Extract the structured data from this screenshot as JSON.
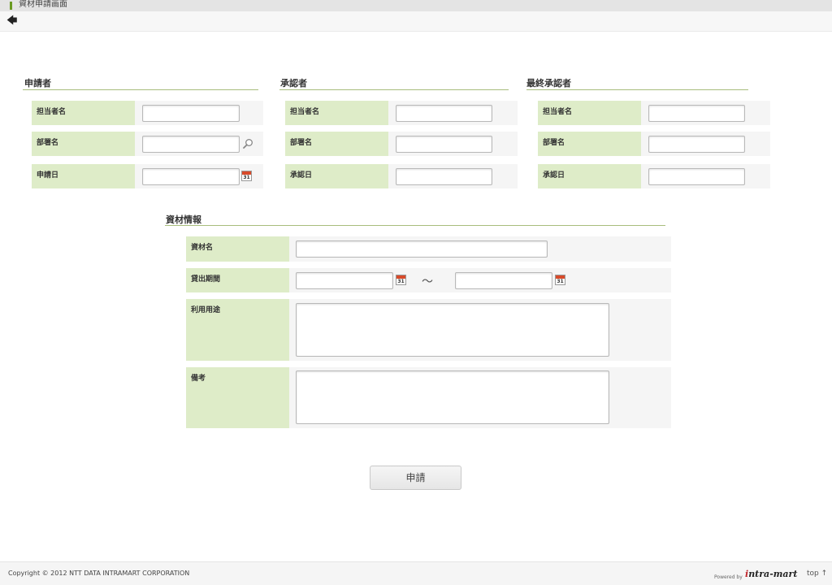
{
  "window": {
    "title": "資材申請画面"
  },
  "toolbar": {
    "back_glyph": "🡄"
  },
  "applicant": {
    "heading": "申請者",
    "fields": [
      {
        "label": "担当者名",
        "value": ""
      },
      {
        "label": "部署名",
        "value": ""
      },
      {
        "label": "申請日",
        "value": ""
      }
    ]
  },
  "approver": {
    "heading": "承認者",
    "fields": [
      {
        "label": "担当者名",
        "value": ""
      },
      {
        "label": "部署名",
        "value": ""
      },
      {
        "label": "承認日",
        "value": ""
      }
    ]
  },
  "final_approver": {
    "heading": "最終承認者",
    "fields": [
      {
        "label": "担当者名",
        "value": ""
      },
      {
        "label": "部署名",
        "value": ""
      },
      {
        "label": "承認日",
        "value": ""
      }
    ]
  },
  "material": {
    "heading": "資材情報",
    "name_label": "資材名",
    "name_value": "",
    "period_label": "貸出期間",
    "period_from": "",
    "period_to": "",
    "tilde": "～",
    "purpose_label": "利用用途",
    "purpose_value": "",
    "remarks_label": "備考",
    "remarks_value": ""
  },
  "icons": {
    "calendar_day": "31",
    "search": "search-icon",
    "calendar": "calendar-icon"
  },
  "actions": {
    "submit_label": "申請"
  },
  "footer": {
    "copyright": "Copyright © 2012 NTT DATA INTRAMART CORPORATION",
    "powered_by": "Powered by",
    "brand_i": "i",
    "brand_rest": "ntra-mart",
    "top_link": "top ↑"
  },
  "colors": {
    "label_bg": "#deecc8",
    "row_bg": "#f5f5f5",
    "section_line": "#a8bd7c",
    "accent": "#6a9a22"
  }
}
